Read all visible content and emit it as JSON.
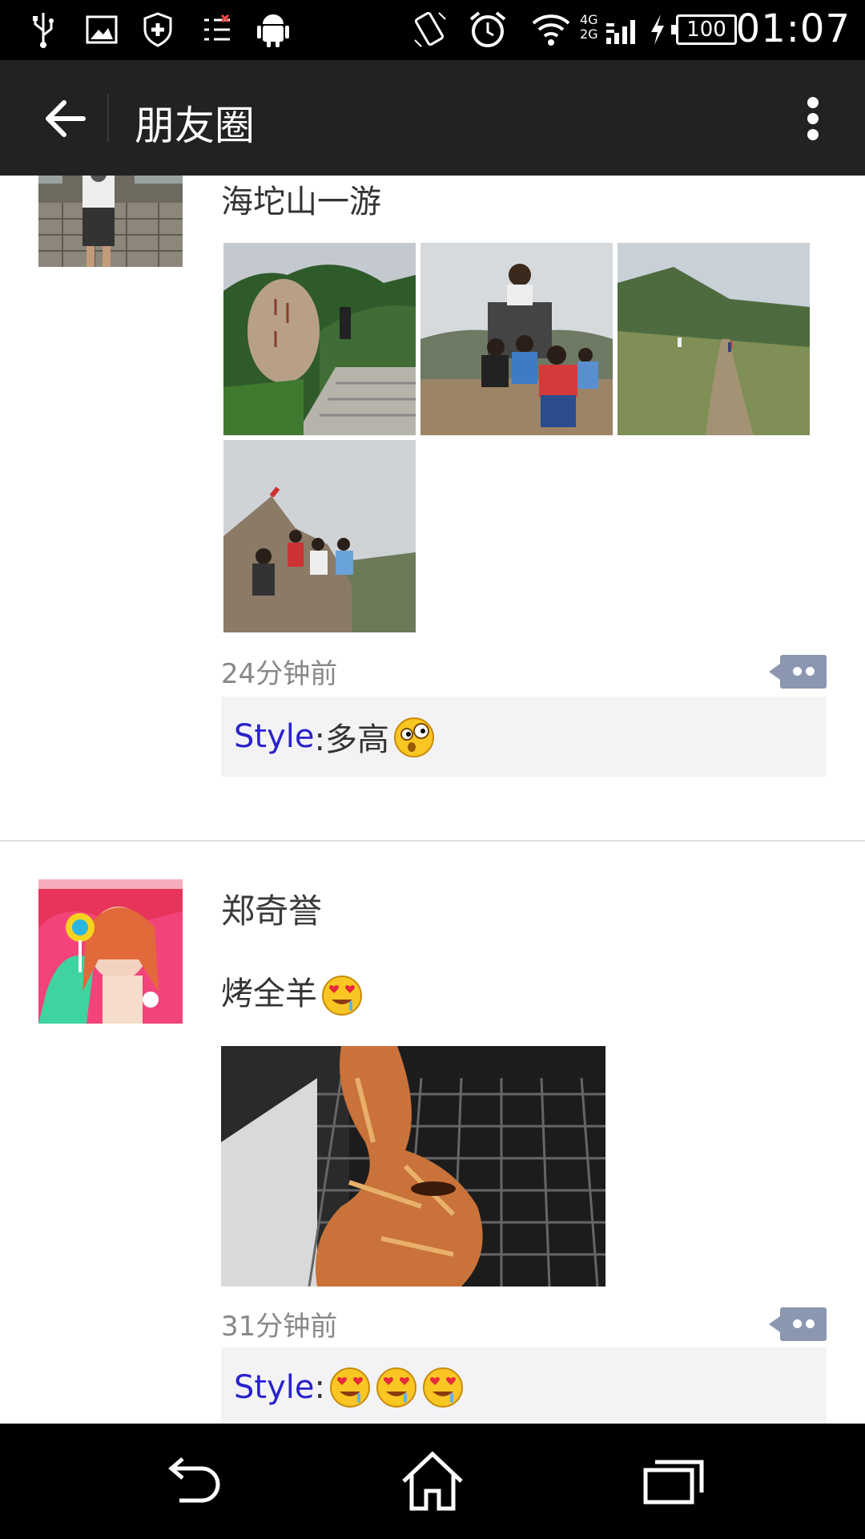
{
  "status_bar": {
    "battery": "100",
    "network_4g": "4G",
    "network_2g": "2G",
    "time": "01:07"
  },
  "title_bar": {
    "title": "朋友圈"
  },
  "posts": [
    {
      "username": "",
      "text": "海坨山一游",
      "time": "24分钟前",
      "comment_author": "Style",
      "comment_text": ":多高",
      "comment_emoji": "dizzy-emoji",
      "photos": [
        "mountain-stone-photo",
        "group-sign-photo",
        "mountain-trail-photo",
        "summit-group-photo"
      ]
    },
    {
      "username": "郑奇誉",
      "text": "烤全羊",
      "text_emoji": "heart-eyes-emoji",
      "time": "31分钟前",
      "comment_author": "Style",
      "comment_text": ":",
      "comment_emojis": [
        "heart-eyes-emoji",
        "heart-eyes-emoji",
        "heart-eyes-emoji"
      ],
      "photos": [
        "roast-lamb-photo"
      ]
    }
  ],
  "nav_bar": {
    "icons": [
      "back-icon",
      "home-icon",
      "recents-icon"
    ]
  },
  "colors": {
    "titlebar_bg": "#222222",
    "comment_author": "#2a22cc",
    "comment_bg": "#f3f3f5",
    "comment_button": "#8b97b0"
  }
}
